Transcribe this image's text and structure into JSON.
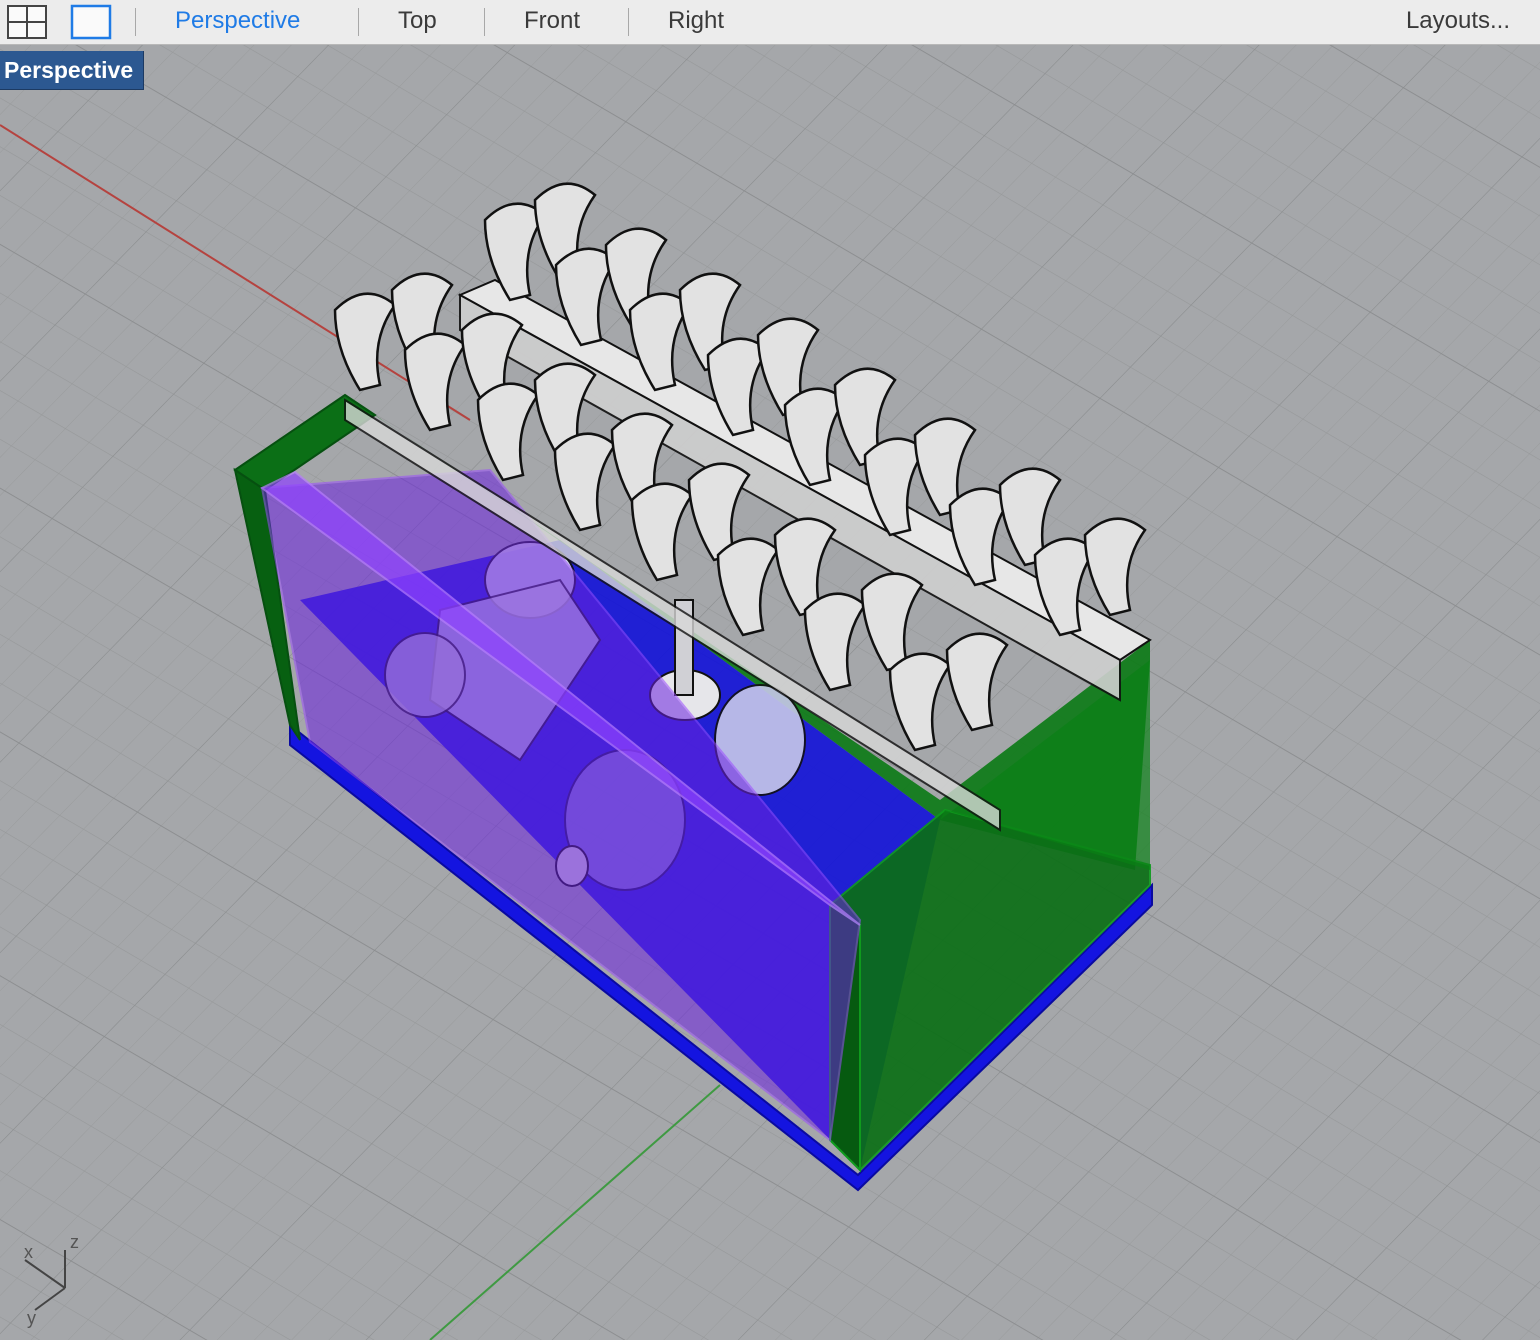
{
  "toolbar": {
    "icons": [
      "four-viewports-icon",
      "single-viewport-icon"
    ],
    "tabs": [
      {
        "label": "Perspective",
        "active": true
      },
      {
        "label": "Top",
        "active": false
      },
      {
        "label": "Front",
        "active": false
      },
      {
        "label": "Right",
        "active": false
      }
    ],
    "layouts_label": "Layouts...",
    "accent_color": "#1f7be6"
  },
  "viewport": {
    "label": "Perspective",
    "label_bg": "#2c5891",
    "background": "#a5a7aa",
    "axis_colors": {
      "x": "#b5433f",
      "y": "#3f9a42"
    },
    "gizmo": {
      "x": "x",
      "y": "y",
      "z": "z"
    },
    "model_colors": {
      "side_panel": "#0a7a14",
      "front_panel": "#7b2bd6",
      "base": "#1414d8",
      "keys": "#e2e2e2"
    }
  }
}
